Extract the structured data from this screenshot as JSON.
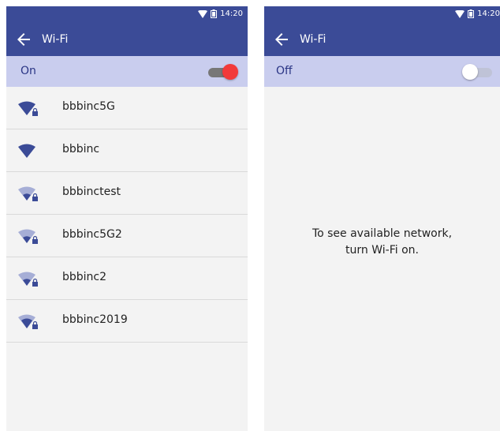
{
  "left_screen": {
    "status": {
      "time": "14:20"
    },
    "title": "Wi-Fi",
    "switch_label": "On",
    "toggle_state": "on",
    "networks": [
      {
        "name": "bbbinc5G",
        "signal": "full",
        "locked": true
      },
      {
        "name": "bbbinc",
        "signal": "full",
        "locked": false
      },
      {
        "name": "bbbinctest",
        "signal": "weak",
        "locked": true
      },
      {
        "name": "bbbinc5G2",
        "signal": "weak",
        "locked": true
      },
      {
        "name": "bbbinc2",
        "signal": "weak",
        "locked": true
      },
      {
        "name": "bbbinc2019",
        "signal": "medium",
        "locked": true
      }
    ]
  },
  "right_screen": {
    "status": {
      "time": "14:20"
    },
    "title": "Wi-Fi",
    "switch_label": "Off",
    "toggle_state": "off",
    "message_line1": "To see available network,",
    "message_line2": "turn Wi-Fi on."
  },
  "colors": {
    "appbar": "#3b4b97",
    "switchbar": "#c9cdee",
    "toggle_on": "#f23a3a",
    "wifi_icon": "#3b4b97"
  }
}
